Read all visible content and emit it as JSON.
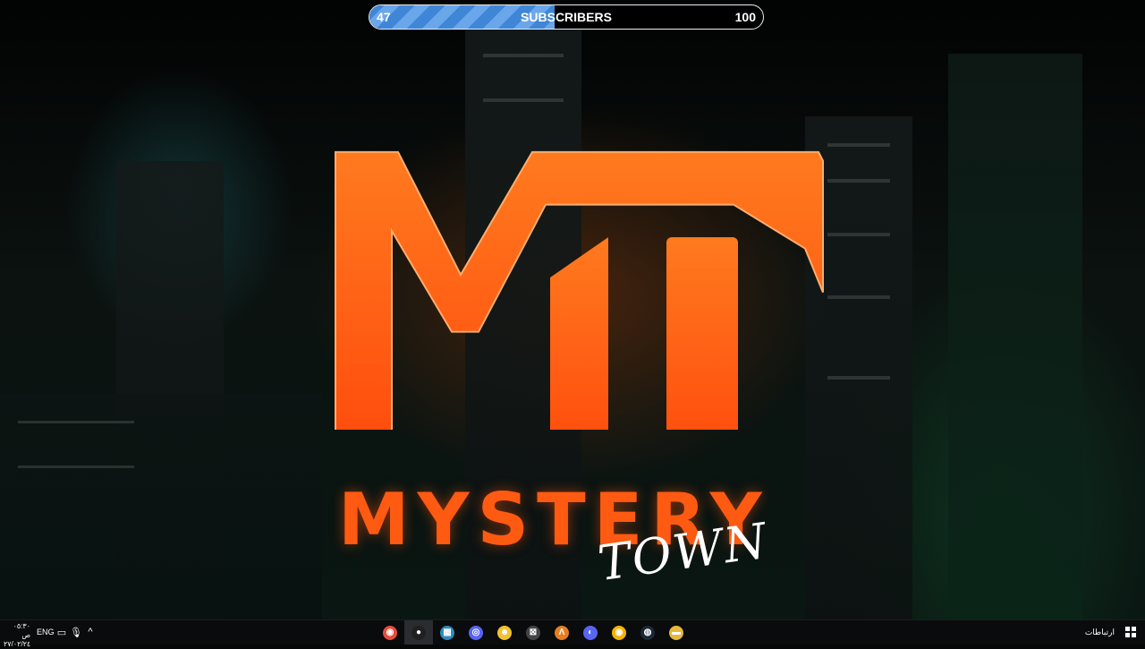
{
  "progress": {
    "current_label": "47",
    "title": "SUBSCRIBERS",
    "max_label": "100",
    "fill_fraction": 0.47,
    "fill_color": "#3f86d6"
  },
  "logo": {
    "initials": "MT",
    "word": "MYSTERY",
    "script": "TOWN",
    "brand_color": "#ff5a12"
  },
  "taskbar": {
    "time": "٠٥:٣٠ ص",
    "date": "٢٧/٠٢/٢٤",
    "language": "ENG",
    "links_label": "ارتباطات",
    "apps": [
      {
        "name": "chrome-icon",
        "glyph": "◉",
        "color": "#e74c3c"
      },
      {
        "name": "obs-icon",
        "glyph": "●",
        "color": "#202020"
      },
      {
        "name": "files-icon",
        "glyph": "▦",
        "color": "#2e8bbf"
      },
      {
        "name": "discord-app-icon",
        "glyph": "◎",
        "color": "#5865f2"
      },
      {
        "name": "emoji-app-icon",
        "glyph": "☻",
        "color": "#f1c232"
      },
      {
        "name": "tool-icon",
        "glyph": "⊠",
        "color": "#444444"
      },
      {
        "name": "launcher-icon",
        "glyph": "Λ",
        "color": "#e67e22"
      },
      {
        "name": "discord-icon",
        "glyph": "◐",
        "color": "#5865f2"
      },
      {
        "name": "chrome-alt-icon",
        "glyph": "◉",
        "color": "#f4b400"
      },
      {
        "name": "steam-icon",
        "glyph": "◍",
        "color": "#1b2838"
      },
      {
        "name": "folder-icon",
        "glyph": "▬",
        "color": "#e8b83a"
      }
    ]
  }
}
